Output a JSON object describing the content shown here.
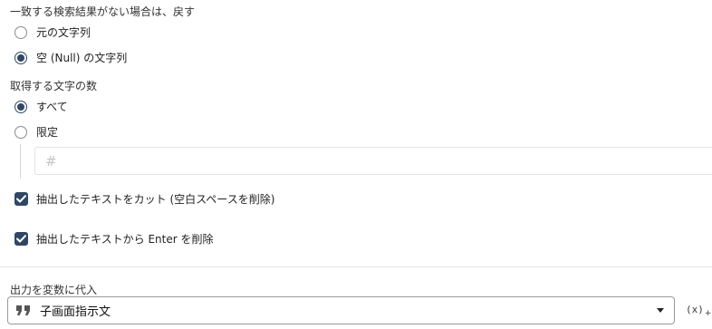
{
  "no_match_section": {
    "title": "一致する検索結果がない場合は、戻す",
    "options": [
      {
        "label": "元の文字列",
        "selected": false
      },
      {
        "label": "空 (Null) の文字列",
        "selected": true
      }
    ]
  },
  "count_section": {
    "title": "取得する文字の数",
    "options": [
      {
        "label": "すべて",
        "selected": true
      },
      {
        "label": "限定",
        "selected": false
      }
    ],
    "limit_input": {
      "icon": "hash-icon",
      "value": ""
    }
  },
  "checkboxes": [
    {
      "label": "抽出したテキストをカット (空白スペースを削除)",
      "checked": true
    },
    {
      "label": "抽出したテキストから Enter を削除",
      "checked": true
    }
  ],
  "output_section": {
    "title": "出力を変数に代入",
    "selected_variable": "子画面指示文",
    "quote_icon": "quote-icon",
    "variable_button": "(x)"
  },
  "colors": {
    "accent": "#2f4764",
    "border": "#9a9a9a"
  }
}
